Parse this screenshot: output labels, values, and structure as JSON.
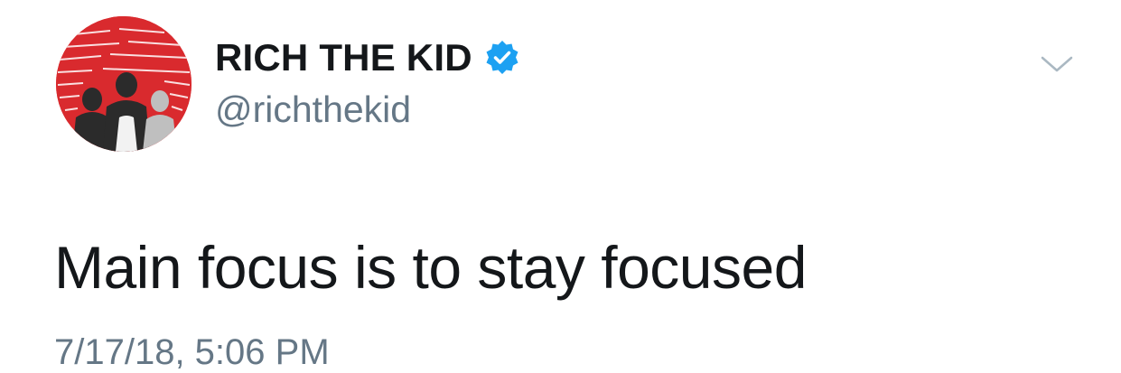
{
  "tweet": {
    "avatar_icon": "profile-avatar-icon",
    "display_name": "RICH THE KID",
    "verified_icon": "verified-badge-icon",
    "handle": "@richthekid",
    "menu_icon": "chevron-down-icon",
    "text": "Main focus is to stay focused",
    "timestamp": "7/17/18, 5:06 PM"
  },
  "colors": {
    "name": "#14171a",
    "secondary": "#657786",
    "verified": "#1da1f2",
    "avatar_bg": "#d92a2e"
  }
}
